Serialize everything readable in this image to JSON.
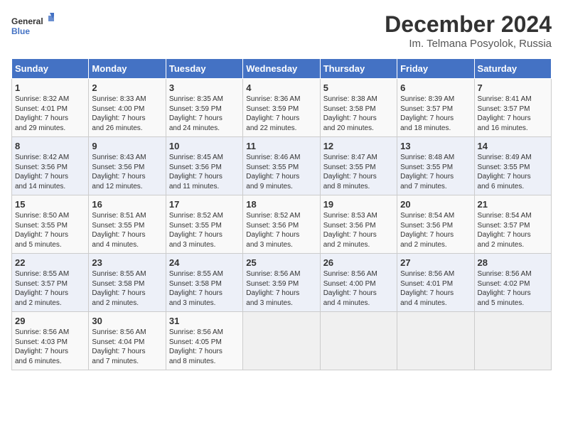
{
  "header": {
    "logo_line1": "General",
    "logo_line2": "Blue",
    "title": "December 2024",
    "subtitle": "Im. Telmana Posyolok, Russia"
  },
  "weekdays": [
    "Sunday",
    "Monday",
    "Tuesday",
    "Wednesday",
    "Thursday",
    "Friday",
    "Saturday"
  ],
  "weeks": [
    [
      {
        "day": "1",
        "info": "Sunrise: 8:32 AM\nSunset: 4:01 PM\nDaylight: 7 hours\nand 29 minutes."
      },
      {
        "day": "2",
        "info": "Sunrise: 8:33 AM\nSunset: 4:00 PM\nDaylight: 7 hours\nand 26 minutes."
      },
      {
        "day": "3",
        "info": "Sunrise: 8:35 AM\nSunset: 3:59 PM\nDaylight: 7 hours\nand 24 minutes."
      },
      {
        "day": "4",
        "info": "Sunrise: 8:36 AM\nSunset: 3:59 PM\nDaylight: 7 hours\nand 22 minutes."
      },
      {
        "day": "5",
        "info": "Sunrise: 8:38 AM\nSunset: 3:58 PM\nDaylight: 7 hours\nand 20 minutes."
      },
      {
        "day": "6",
        "info": "Sunrise: 8:39 AM\nSunset: 3:57 PM\nDaylight: 7 hours\nand 18 minutes."
      },
      {
        "day": "7",
        "info": "Sunrise: 8:41 AM\nSunset: 3:57 PM\nDaylight: 7 hours\nand 16 minutes."
      }
    ],
    [
      {
        "day": "8",
        "info": "Sunrise: 8:42 AM\nSunset: 3:56 PM\nDaylight: 7 hours\nand 14 minutes."
      },
      {
        "day": "9",
        "info": "Sunrise: 8:43 AM\nSunset: 3:56 PM\nDaylight: 7 hours\nand 12 minutes."
      },
      {
        "day": "10",
        "info": "Sunrise: 8:45 AM\nSunset: 3:56 PM\nDaylight: 7 hours\nand 11 minutes."
      },
      {
        "day": "11",
        "info": "Sunrise: 8:46 AM\nSunset: 3:55 PM\nDaylight: 7 hours\nand 9 minutes."
      },
      {
        "day": "12",
        "info": "Sunrise: 8:47 AM\nSunset: 3:55 PM\nDaylight: 7 hours\nand 8 minutes."
      },
      {
        "day": "13",
        "info": "Sunrise: 8:48 AM\nSunset: 3:55 PM\nDaylight: 7 hours\nand 7 minutes."
      },
      {
        "day": "14",
        "info": "Sunrise: 8:49 AM\nSunset: 3:55 PM\nDaylight: 7 hours\nand 6 minutes."
      }
    ],
    [
      {
        "day": "15",
        "info": "Sunrise: 8:50 AM\nSunset: 3:55 PM\nDaylight: 7 hours\nand 5 minutes."
      },
      {
        "day": "16",
        "info": "Sunrise: 8:51 AM\nSunset: 3:55 PM\nDaylight: 7 hours\nand 4 minutes."
      },
      {
        "day": "17",
        "info": "Sunrise: 8:52 AM\nSunset: 3:55 PM\nDaylight: 7 hours\nand 3 minutes."
      },
      {
        "day": "18",
        "info": "Sunrise: 8:52 AM\nSunset: 3:56 PM\nDaylight: 7 hours\nand 3 minutes."
      },
      {
        "day": "19",
        "info": "Sunrise: 8:53 AM\nSunset: 3:56 PM\nDaylight: 7 hours\nand 2 minutes."
      },
      {
        "day": "20",
        "info": "Sunrise: 8:54 AM\nSunset: 3:56 PM\nDaylight: 7 hours\nand 2 minutes."
      },
      {
        "day": "21",
        "info": "Sunrise: 8:54 AM\nSunset: 3:57 PM\nDaylight: 7 hours\nand 2 minutes."
      }
    ],
    [
      {
        "day": "22",
        "info": "Sunrise: 8:55 AM\nSunset: 3:57 PM\nDaylight: 7 hours\nand 2 minutes."
      },
      {
        "day": "23",
        "info": "Sunrise: 8:55 AM\nSunset: 3:58 PM\nDaylight: 7 hours\nand 2 minutes."
      },
      {
        "day": "24",
        "info": "Sunrise: 8:55 AM\nSunset: 3:58 PM\nDaylight: 7 hours\nand 3 minutes."
      },
      {
        "day": "25",
        "info": "Sunrise: 8:56 AM\nSunset: 3:59 PM\nDaylight: 7 hours\nand 3 minutes."
      },
      {
        "day": "26",
        "info": "Sunrise: 8:56 AM\nSunset: 4:00 PM\nDaylight: 7 hours\nand 4 minutes."
      },
      {
        "day": "27",
        "info": "Sunrise: 8:56 AM\nSunset: 4:01 PM\nDaylight: 7 hours\nand 4 minutes."
      },
      {
        "day": "28",
        "info": "Sunrise: 8:56 AM\nSunset: 4:02 PM\nDaylight: 7 hours\nand 5 minutes."
      }
    ],
    [
      {
        "day": "29",
        "info": "Sunrise: 8:56 AM\nSunset: 4:03 PM\nDaylight: 7 hours\nand 6 minutes."
      },
      {
        "day": "30",
        "info": "Sunrise: 8:56 AM\nSunset: 4:04 PM\nDaylight: 7 hours\nand 7 minutes."
      },
      {
        "day": "31",
        "info": "Sunrise: 8:56 AM\nSunset: 4:05 PM\nDaylight: 7 hours\nand 8 minutes."
      },
      {
        "day": "",
        "info": ""
      },
      {
        "day": "",
        "info": ""
      },
      {
        "day": "",
        "info": ""
      },
      {
        "day": "",
        "info": ""
      }
    ]
  ]
}
